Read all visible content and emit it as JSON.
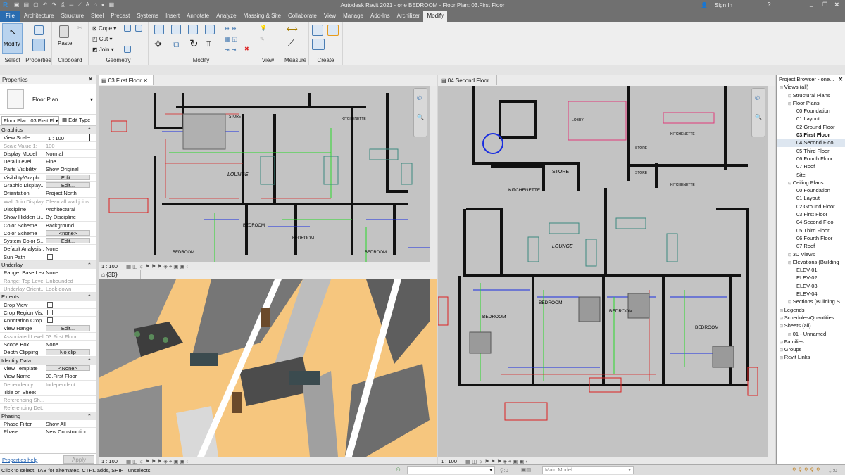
{
  "window": {
    "title": "Autodesk Revit 2021 - one BEDROOM - Floor Plan: 03.First Floor",
    "sign_in": "Sign In"
  },
  "tabs": [
    "File",
    "Architecture",
    "Structure",
    "Steel",
    "Precast",
    "Systems",
    "Insert",
    "Annotate",
    "Analyze",
    "Massing & Site",
    "Collaborate",
    "View",
    "Manage",
    "Add-Ins",
    "Archilizer",
    "Modify"
  ],
  "ribbon": {
    "modify": "Modify",
    "select": "Select",
    "properties": "Properties",
    "paste": "Paste",
    "clipboard": "Clipboard",
    "cope": "Cope",
    "cut": "Cut",
    "join": "Join",
    "geometry": "Geometry",
    "modify_panel": "Modify",
    "view": "View",
    "measure": "Measure",
    "create": "Create"
  },
  "properties": {
    "title": "Properties",
    "type": "Floor Plan",
    "selector": "Floor Plan: 03.First Fl",
    "edit_type": "Edit Type",
    "groups": [
      {
        "name": "Graphics",
        "rows": [
          [
            "View Scale",
            "1 : 100",
            "input"
          ],
          [
            "Scale Value    1:",
            "100",
            "dim"
          ],
          [
            "Display Model",
            "Normal"
          ],
          [
            "Detail Level",
            "Fine"
          ],
          [
            "Parts Visibility",
            "Show Original"
          ],
          [
            "Visibility/Graphi...",
            "Edit...",
            "btn"
          ],
          [
            "Graphic Display...",
            "Edit...",
            "btn"
          ],
          [
            "Orientation",
            "Project North"
          ],
          [
            "Wall Join Display",
            "Clean all wall joins",
            "dim"
          ],
          [
            "Discipline",
            "Architectural"
          ],
          [
            "Show Hidden Li...",
            "By Discipline"
          ],
          [
            "Color Scheme L...",
            "Background"
          ],
          [
            "Color Scheme",
            "<none>",
            "btn"
          ],
          [
            "System Color S...",
            "Edit...",
            "btn"
          ],
          [
            "Default Analysis...",
            "None"
          ],
          [
            "Sun Path",
            "",
            "chk"
          ]
        ]
      },
      {
        "name": "Underlay",
        "rows": [
          [
            "Range: Base Level",
            "None"
          ],
          [
            "Range: Top Level",
            "Unbounded",
            "dim"
          ],
          [
            "Underlay Orient...",
            "Look down",
            "dim"
          ]
        ]
      },
      {
        "name": "Extents",
        "rows": [
          [
            "Crop View",
            "",
            "chk"
          ],
          [
            "Crop Region Vis...",
            "",
            "chk"
          ],
          [
            "Annotation Crop",
            "",
            "chk"
          ],
          [
            "View Range",
            "Edit...",
            "btn"
          ],
          [
            "Associated Level",
            "03.First Floor",
            "dim"
          ],
          [
            "Scope Box",
            "None"
          ],
          [
            "Depth Clipping",
            "No clip",
            "btn"
          ]
        ]
      },
      {
        "name": "Identity Data",
        "rows": [
          [
            "View Template",
            "<None>",
            "btn"
          ],
          [
            "View Name",
            "03.First Floor"
          ],
          [
            "Dependency",
            "Independent",
            "dim"
          ],
          [
            "Title on Sheet",
            ""
          ],
          [
            "Referencing Sh...",
            "",
            "dim"
          ],
          [
            "Referencing Det...",
            "",
            "dim"
          ]
        ]
      },
      {
        "name": "Phasing",
        "rows": [
          [
            "Phase Filter",
            "Show All"
          ],
          [
            "Phase",
            "New Construction"
          ]
        ]
      }
    ],
    "help": "Properties help",
    "apply": "Apply"
  },
  "views": {
    "first": {
      "tab": "03.First Floor",
      "scale": "1 : 100"
    },
    "three_d": {
      "tab": "{3D}",
      "scale": "1 : 100"
    },
    "second": {
      "tab": "04.Second Floor",
      "scale": "1 : 100"
    }
  },
  "rooms": {
    "lounge": "LOUNGE",
    "bedroom": "BEDROOM",
    "kitchenette": "KITCHENETTE",
    "store": "STORE",
    "lobby": "LOBBY"
  },
  "browser": {
    "title": "Project Browser - one...",
    "items": [
      [
        0,
        "Views (all)"
      ],
      [
        1,
        "Structural Plans"
      ],
      [
        1,
        "Floor Plans"
      ],
      [
        2,
        "00.Foundation"
      ],
      [
        2,
        "01.Layout"
      ],
      [
        2,
        "02.Ground Floor"
      ],
      [
        2,
        "03.First Floor",
        "bold"
      ],
      [
        2,
        "04.Second Floo",
        "sel"
      ],
      [
        2,
        "05.Third  Floor"
      ],
      [
        2,
        "06.Fourth Floor"
      ],
      [
        2,
        "07.Roof"
      ],
      [
        2,
        "Site"
      ],
      [
        1,
        "Ceiling Plans"
      ],
      [
        2,
        "00.Foundation"
      ],
      [
        2,
        "01.Layout"
      ],
      [
        2,
        "02.Ground Floor"
      ],
      [
        2,
        "03.First Floor"
      ],
      [
        2,
        "04.Second Floo"
      ],
      [
        2,
        "05.Third  Floor"
      ],
      [
        2,
        "06.Fourth Floor"
      ],
      [
        2,
        "07.Roof"
      ],
      [
        1,
        "3D Views"
      ],
      [
        1,
        "Elevations (Building"
      ],
      [
        2,
        "ELEV-01"
      ],
      [
        2,
        "ELEV-02"
      ],
      [
        2,
        "ELEV-03"
      ],
      [
        2,
        "ELEV-04"
      ],
      [
        1,
        "Sections (Building S"
      ],
      [
        0,
        "Legends"
      ],
      [
        0,
        "Schedules/Quantities"
      ],
      [
        0,
        "Sheets (all)"
      ],
      [
        1,
        "01 - Unnamed"
      ],
      [
        0,
        "Families"
      ],
      [
        0,
        "Groups"
      ],
      [
        0,
        "Revit Links"
      ]
    ]
  },
  "status": {
    "hint": "Click to select, TAB for alternates, CTRL adds, SHIFT unselects.",
    "workset_count": ":0",
    "model": "Main Model",
    "filter_count": ":0"
  }
}
